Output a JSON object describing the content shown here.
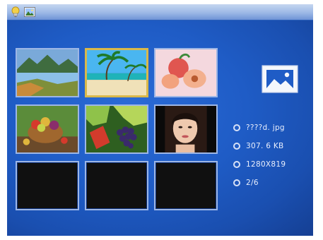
{
  "toolbar": {
    "icons": [
      "lightbulb-icon",
      "photo-icon"
    ]
  },
  "thumbnails": [
    {
      "name": "landscape-river",
      "selected": false
    },
    {
      "name": "tropical-beach",
      "selected": true
    },
    {
      "name": "peaches",
      "selected": false
    },
    {
      "name": "fruit-basket",
      "selected": false
    },
    {
      "name": "grapes-leaves",
      "selected": false
    },
    {
      "name": "portrait-woman",
      "selected": false
    },
    {
      "name": "empty-slot",
      "selected": false
    },
    {
      "name": "empty-slot",
      "selected": false
    },
    {
      "name": "empty-slot",
      "selected": false
    }
  ],
  "details": {
    "filename": "????d. jpg",
    "filesize": "307. 6 KB",
    "resolution": "1280X819",
    "position": "2/6"
  },
  "colors": {
    "background": "#1f5cc6",
    "selection": "#d9b84a",
    "thumb_border": "#9db6e6",
    "text": "#e8eefc"
  }
}
